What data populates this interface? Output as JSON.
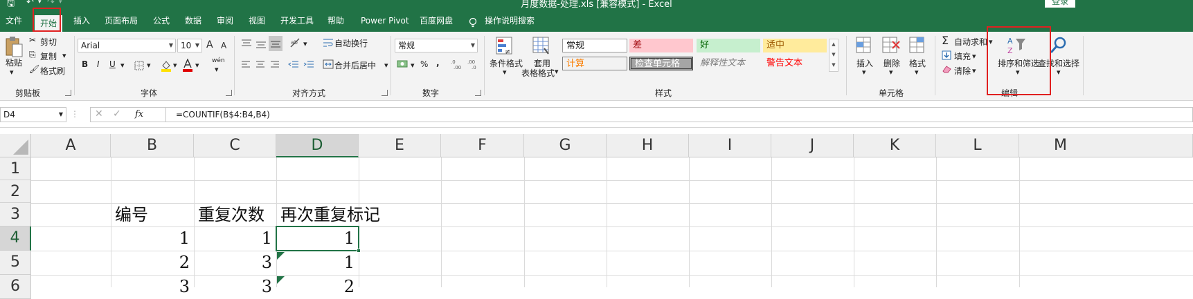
{
  "titlebar": {
    "title": "月度数据-处理.xls  [兼容模式]  -  Excel",
    "sign_in": "登录"
  },
  "tabs": [
    "文件",
    "开始",
    "插入",
    "页面布局",
    "公式",
    "数据",
    "审阅",
    "视图",
    "开发工具",
    "帮助",
    "Power Pivot",
    "百度网盘",
    "操作说明搜索"
  ],
  "ribbon": {
    "clipboard": {
      "paste": "粘贴",
      "cut": "剪切",
      "copy": "复制",
      "format_painter": "格式刷",
      "label": "剪贴板"
    },
    "font": {
      "family": "Arial",
      "size": "10",
      "bold": "B",
      "italic": "I",
      "underline": "U",
      "grow": "A",
      "shrink": "A",
      "label": "字体",
      "phonetic": "wén"
    },
    "alignment": {
      "wrap": "自动换行",
      "merge": "合并后居中",
      "label": "对齐方式"
    },
    "number": {
      "format": "常规",
      "percent": "%",
      "comma": ",",
      "label": "数字"
    },
    "styles": {
      "conditional": "条件格式",
      "table_top": "套用",
      "table_bottom": "表格格式",
      "normal": "常规",
      "bad": "差",
      "good": "好",
      "neutral": "适中",
      "calculation": "计算",
      "check_cell": "检查单元格",
      "explanatory": "解释性文本",
      "warning": "警告文本",
      "label": "样式"
    },
    "cells": {
      "insert": "插入",
      "delete": "删除",
      "format": "格式",
      "label": "单元格"
    },
    "editing": {
      "autosum": "自动求和",
      "fill": "填充",
      "clear": "清除",
      "sort_filter": "排序和筛选",
      "find_select": "查找和选择",
      "label": "编辑"
    }
  },
  "formula_bar": {
    "name_box": "D4",
    "fx": "fx",
    "formula": "=COUNTIF(B$4:B4,B4)"
  },
  "sheet": {
    "columns": [
      "A",
      "B",
      "C",
      "D",
      "E",
      "F",
      "G",
      "H",
      "I",
      "J",
      "K",
      "L",
      "M"
    ],
    "rows": [
      "1",
      "2",
      "3",
      "4",
      "5",
      "6"
    ],
    "cells": {
      "B3": "编号",
      "C3": "重复次数",
      "D3": "再次重复标记",
      "B4": "1",
      "C4": "1",
      "D4": "1",
      "B5": "2",
      "C5": "3",
      "D5": "1",
      "B6": "3",
      "C6": "3",
      "D6": "2"
    }
  },
  "colors": {
    "accent": "#217346",
    "highlight_box": "#e02020"
  }
}
